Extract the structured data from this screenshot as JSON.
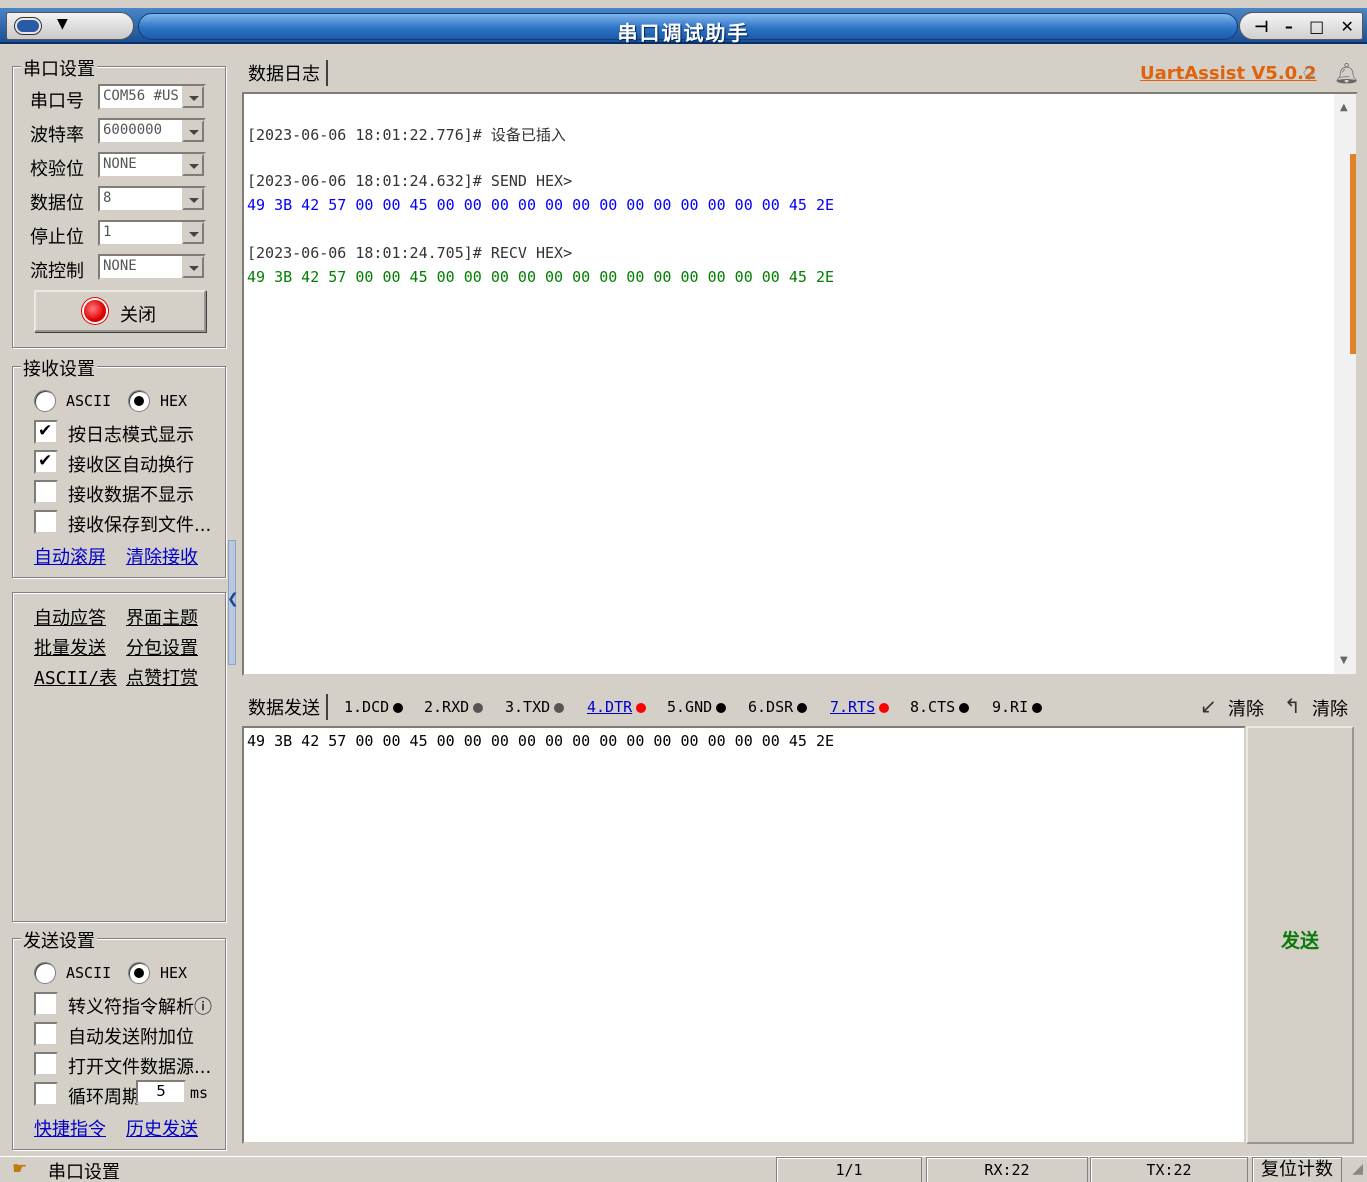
{
  "window": {
    "title": "串口调试助手",
    "buttons": {
      "pin": "⊣",
      "minimize": "–",
      "maximize": "□",
      "close": "✕"
    }
  },
  "port_settings": {
    "title": "串口设置",
    "rows": [
      {
        "label": "串口号",
        "value": "COM56 #US"
      },
      {
        "label": "波特率",
        "value": "6000000"
      },
      {
        "label": "校验位",
        "value": "NONE"
      },
      {
        "label": "数据位",
        "value": "8"
      },
      {
        "label": "停止位",
        "value": "1"
      },
      {
        "label": "流控制",
        "value": "NONE"
      }
    ],
    "toggle_button": "关闭"
  },
  "recv_settings": {
    "title": "接收设置",
    "ascii": "ASCII",
    "hex": "HEX",
    "checks": [
      {
        "label": "按日志模式显示",
        "checked": true
      },
      {
        "label": "接收区自动换行",
        "checked": true
      },
      {
        "label": "接收数据不显示",
        "checked": false
      },
      {
        "label": "接收保存到文件...",
        "checked": false
      }
    ],
    "link_autoscroll": "自动滚屏",
    "link_clear": "清除接收"
  },
  "tools": {
    "items": [
      "自动应答",
      "界面主题",
      "批量发送",
      "分包设置",
      "ASCII/表",
      "点赞打赏"
    ]
  },
  "send_settings": {
    "title": "发送设置",
    "ascii": "ASCII",
    "hex": "HEX",
    "checks": [
      {
        "label": "转义符指令解析ⓘ",
        "checked": false
      },
      {
        "label": "自动发送附加位",
        "checked": false
      },
      {
        "label": "打开文件数据源...",
        "checked": false
      },
      {
        "label": "循环周期",
        "checked": false
      }
    ],
    "period_value": "5",
    "period_unit": "ms",
    "link_shortcut": "快捷指令",
    "link_history": "历史发送"
  },
  "log": {
    "tab": "数据日志",
    "version_link": "UartAssist V5.0.2",
    "lines": [
      {
        "text": "[2023-06-06 18:01:22.776]# 设备已插入",
        "color": "#333333"
      },
      {
        "text": "[2023-06-06 18:01:24.632]# SEND HEX>",
        "color": "#333333"
      },
      {
        "text": "49 3B 42 57 00 00 45 00 00 00 00 00 00 00 00 00 00 00 00 00 45 2E",
        "color": "#0000ff"
      },
      {
        "text": "[2023-06-06 18:01:24.705]# RECV HEX>",
        "color": "#333333"
      },
      {
        "text": "49 3B 42 57 00 00 45 00 00 00 00 00 00 00 00 00 00 00 00 00 45 2E",
        "color": "#008000"
      }
    ]
  },
  "send": {
    "tab": "数据发送",
    "pins": [
      {
        "label": "1.DCD",
        "color": "#000000"
      },
      {
        "label": "2.RXD",
        "color": "#555555"
      },
      {
        "label": "3.TXD",
        "color": "#555555"
      },
      {
        "label": "4.DTR",
        "color": "#ff0000"
      },
      {
        "label": "5.GND",
        "color": "#000000"
      },
      {
        "label": "6.DSR",
        "color": "#000000"
      },
      {
        "label": "7.RTS",
        "color": "#ff0000"
      },
      {
        "label": "8.CTS",
        "color": "#000000"
      },
      {
        "label": "9.RI",
        "color": "#000000"
      }
    ],
    "clear1": "清除",
    "clear2": "清除",
    "content": "49 3B 42 57 00 00 45 00 00 00 00 00 00 00 00 00 00 00 00 00 45 2E",
    "button": "发送"
  },
  "status": {
    "left": "串口设置",
    "page": "1/1",
    "rx": "RX:22",
    "tx": "TX:22",
    "reset": "复位计数"
  }
}
